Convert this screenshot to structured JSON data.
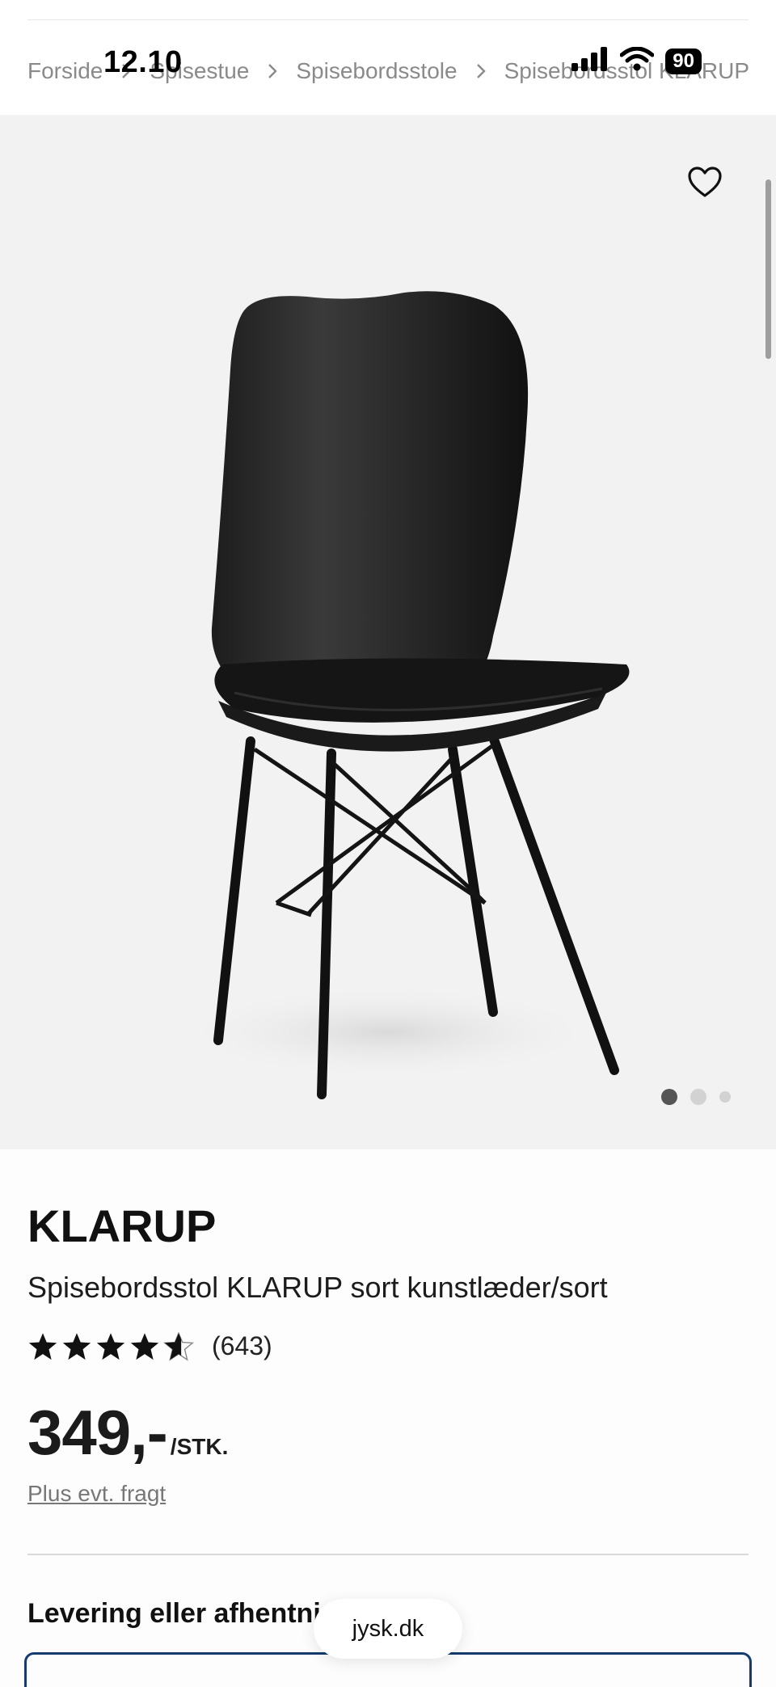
{
  "status_bar": {
    "time": "12.10",
    "battery": "90"
  },
  "breadcrumb": [
    "Forside",
    "Spisestue",
    "Spisebordsstole",
    "Spisebordsstol KLARUP"
  ],
  "gallery": {
    "slide_count": 3,
    "active_slide": 1
  },
  "product": {
    "brand": "KLARUP",
    "name": "Spisebordsstol KLARUP sort kunstlæder/sort",
    "rating": 4.5,
    "review_count": "(643)",
    "price": "349,-",
    "unit": "/STK.",
    "freight_note": "Plus evt. fragt"
  },
  "delivery": {
    "title": "Levering eller afhentning?"
  },
  "browser": {
    "url": "jysk.dk"
  },
  "icons": {
    "favorite": "heart-outline-icon",
    "breadcrumb_separator": "chevron-right-icon",
    "signal": "cellular-signal-icon",
    "wifi": "wifi-icon"
  }
}
